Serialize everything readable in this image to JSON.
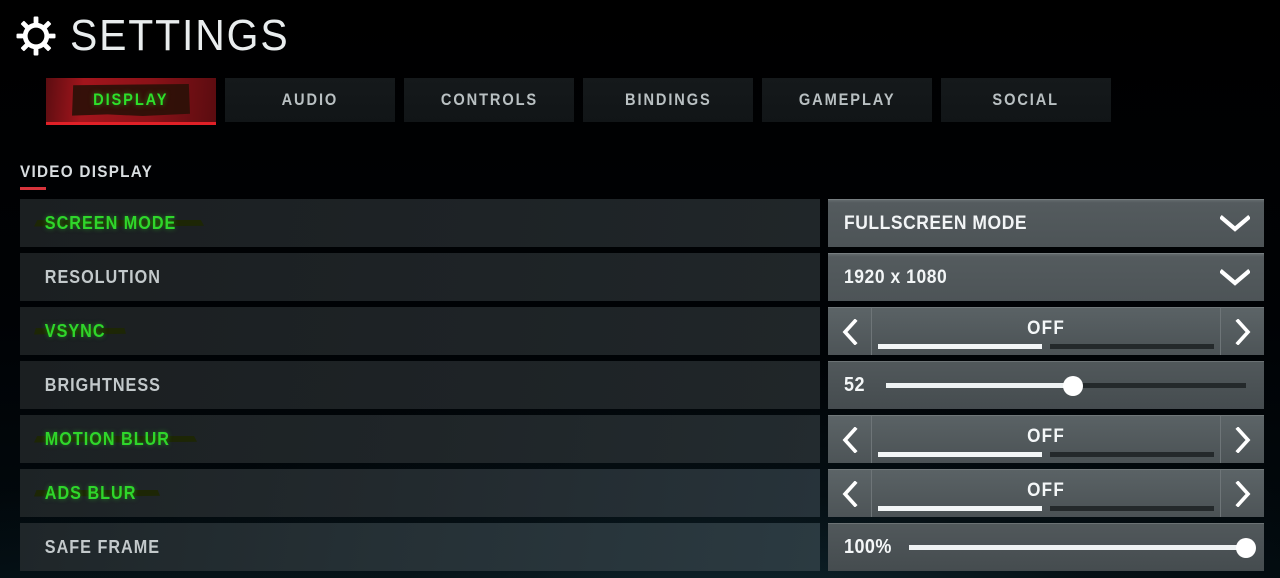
{
  "header": {
    "title": "SETTINGS",
    "gear_icon": "gear-icon"
  },
  "tabs": [
    {
      "label": "DISPLAY",
      "active": true
    },
    {
      "label": "AUDIO",
      "active": false
    },
    {
      "label": "CONTROLS",
      "active": false
    },
    {
      "label": "BINDINGS",
      "active": false
    },
    {
      "label": "GAMEPLAY",
      "active": false
    },
    {
      "label": "SOCIAL",
      "active": false
    }
  ],
  "section": {
    "title": "VIDEO DISPLAY"
  },
  "rows": [
    {
      "label": "SCREEN MODE",
      "highlighted": true,
      "control": "dropdown",
      "value": "FULLSCREEN MODE",
      "icon": "chevron-down-icon"
    },
    {
      "label": "RESOLUTION",
      "highlighted": false,
      "control": "dropdown",
      "value": "1920 x 1080",
      "icon": "chevron-down-icon"
    },
    {
      "label": "VSYNC",
      "highlighted": true,
      "control": "stepper",
      "value": "OFF",
      "segments": 2,
      "active_segment": 1,
      "prev_icon": "chevron-left-icon",
      "next_icon": "chevron-right-icon"
    },
    {
      "label": "BRIGHTNESS",
      "highlighted": false,
      "control": "slider",
      "value": "52",
      "percent": 52
    },
    {
      "label": "MOTION BLUR",
      "highlighted": true,
      "control": "stepper",
      "value": "OFF",
      "segments": 2,
      "active_segment": 1,
      "prev_icon": "chevron-left-icon",
      "next_icon": "chevron-right-icon"
    },
    {
      "label": "ADS BLUR",
      "highlighted": true,
      "control": "stepper",
      "value": "OFF",
      "segments": 2,
      "active_segment": 1,
      "prev_icon": "chevron-left-icon",
      "next_icon": "chevron-right-icon"
    },
    {
      "label": "SAFE FRAME",
      "highlighted": false,
      "control": "slider",
      "value": "100%",
      "percent": 100
    }
  ],
  "colors": {
    "accent_red": "#d8343c",
    "highlight_green": "#2fd62b",
    "tab_active_red": "#a3151c",
    "control_gray": "#545b5e",
    "text_light": "#c3c9cb"
  }
}
